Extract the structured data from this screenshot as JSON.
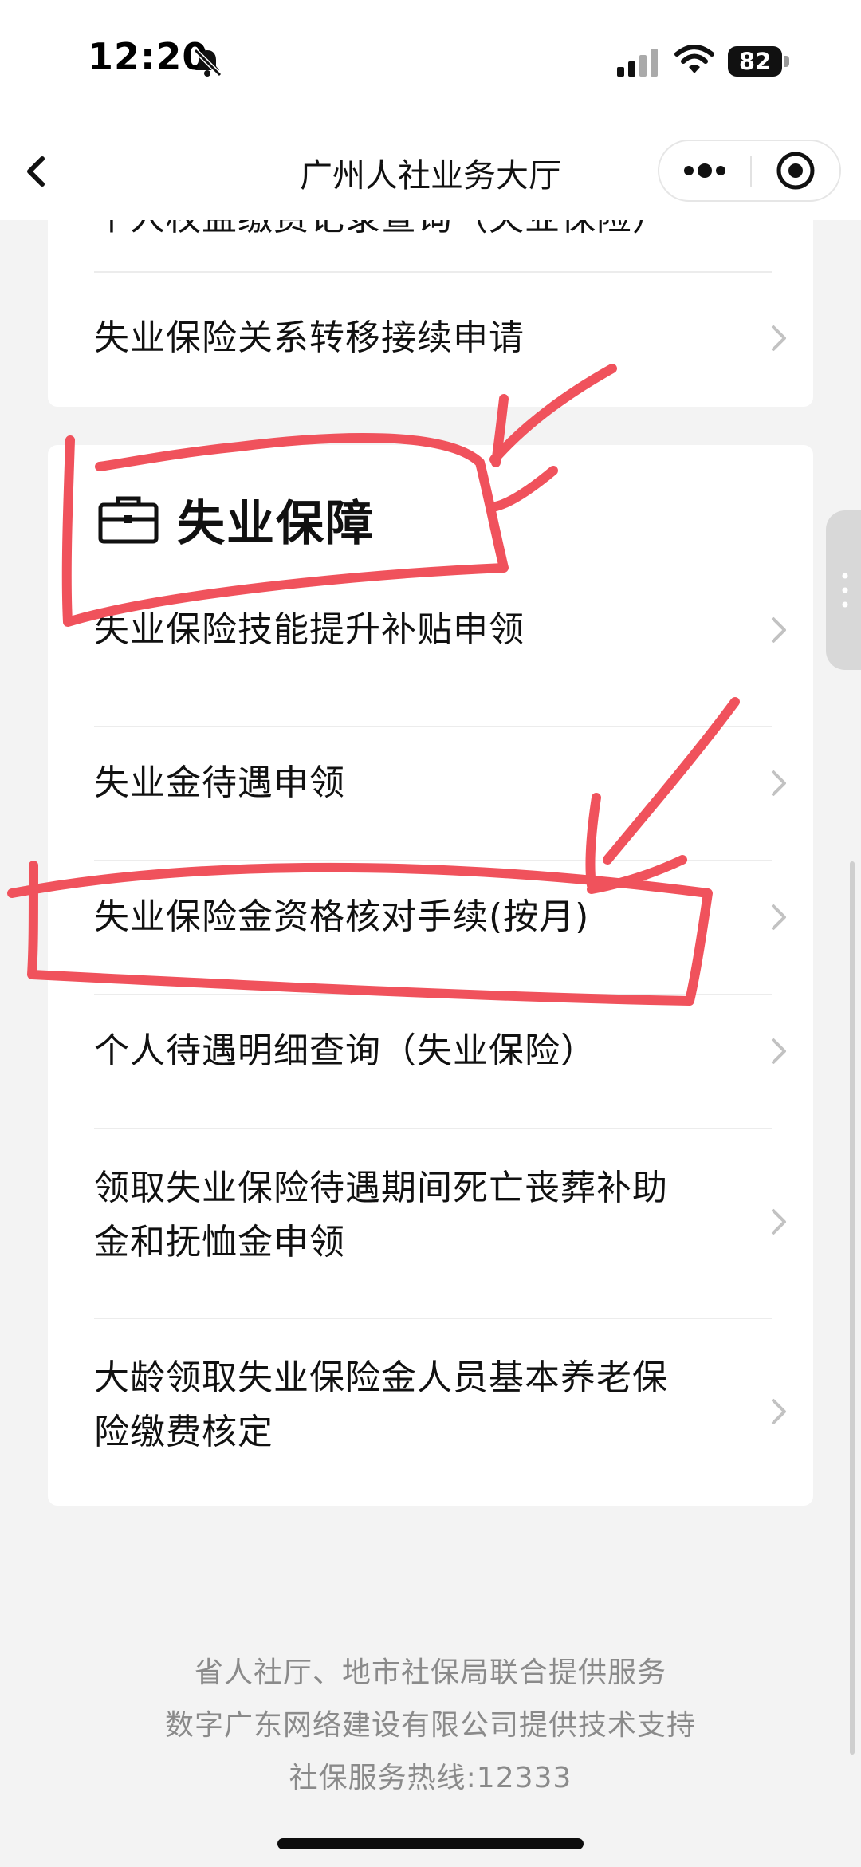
{
  "status_bar": {
    "time": "12:20",
    "battery": "82",
    "icons": [
      "bell-slash-icon",
      "signal-icon",
      "wifi-icon",
      "battery-icon"
    ]
  },
  "nav": {
    "title": "广州人社业务大厅",
    "back_icon": "chevron-left-icon",
    "more_icon": "more-dots-icon",
    "close_icon": "target-close-icon"
  },
  "top_card": {
    "partial_item": "个人权益缴费记录查询（失业保险）",
    "items": [
      {
        "label": "失业保险关系转移接续申请"
      }
    ]
  },
  "section": {
    "title": "失业保障",
    "icon": "briefcase-icon",
    "items": [
      {
        "label": "失业保险技能提升补贴申领"
      },
      {
        "label": "失业金待遇申领"
      },
      {
        "label": "失业保险金资格核对手续(按月)"
      },
      {
        "label": "个人待遇明细查询（失业保险）"
      },
      {
        "label_line1": "领取失业保险待遇期间死亡丧葬补助",
        "label_line2": "金和抚恤金申领"
      },
      {
        "label_line1": "大龄领取失业保险金人员基本养老保",
        "label_line2": "险缴费核定"
      }
    ]
  },
  "footer": {
    "line1": "省人社厅、地市社保局联合提供服务",
    "line2": "数字广东网络建设有限公司提供技术支持",
    "line3": "社保服务热线:12333"
  },
  "colors": {
    "annotation": "#f0525c",
    "chevron": "#c2c2c2",
    "background": "#f3f3f3"
  }
}
